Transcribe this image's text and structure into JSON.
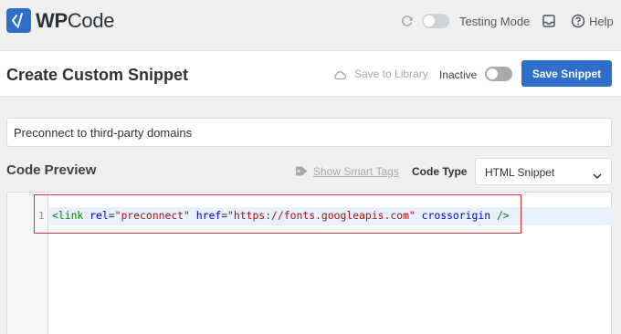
{
  "app": {
    "logo_prefix": "WP",
    "logo_suffix": "Code",
    "testing_mode_label": "Testing Mode",
    "help_label": "Help"
  },
  "header": {
    "title": "Create Custom Snippet",
    "save_to_library_label": "Save to Library",
    "status_label": "Inactive",
    "save_button_label": "Save Snippet"
  },
  "snippet": {
    "title_value": "Preconnect to third-party domains"
  },
  "code_preview": {
    "section_title": "Code Preview",
    "smart_tags_label": "Show Smart Tags",
    "code_type_label": "Code Type",
    "code_type_value": "HTML Snippet",
    "line_number": "1",
    "tokens": {
      "open": "<link",
      "attr1": "rel",
      "eq": "=",
      "val1": "\"preconnect\"",
      "attr2": "href",
      "val2": "\"https://fonts.googleapis.com\"",
      "attr3": "crossorigin",
      "close": "/>"
    }
  },
  "colors": {
    "accent": "#2f6fcb",
    "highlight_border": "#d63638",
    "active_line": "#e8f2ff"
  },
  "icons": [
    "logo-icon",
    "refresh-icon",
    "inbox-icon",
    "help-icon",
    "cloud-icon",
    "tag-icon",
    "chevron-down-icon"
  ]
}
